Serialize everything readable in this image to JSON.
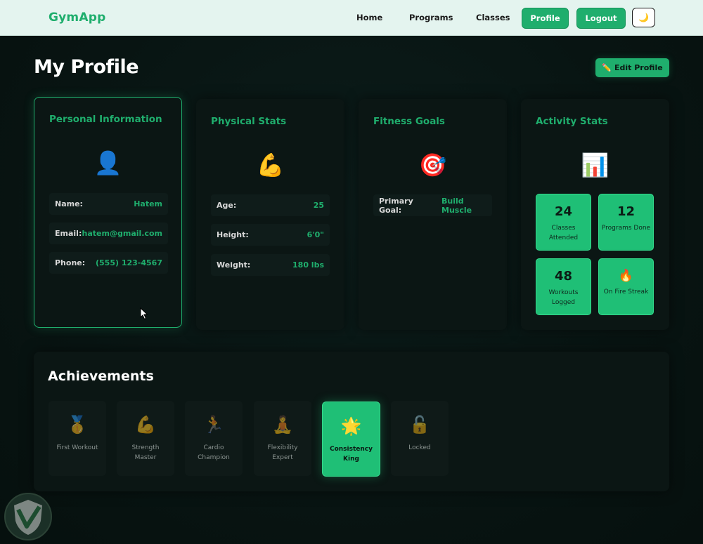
{
  "nav": {
    "logo": "GymApp",
    "links": [
      "Home",
      "Programs",
      "Classes"
    ],
    "profile_label": "Profile",
    "logout_label": "Logout",
    "theme_icon": "moon-icon"
  },
  "page": {
    "title": "My Profile",
    "edit_label": "Edit Profile",
    "edit_icon": "pencil-icon"
  },
  "personal": {
    "title": "Personal Information",
    "icon": "user-icon",
    "rows": [
      {
        "label": "Name:",
        "value": "Hatem"
      },
      {
        "label": "Email:",
        "value": "hatem@gmail.com"
      },
      {
        "label": "Phone:",
        "value": "(555) 123-4567"
      }
    ]
  },
  "physical": {
    "title": "Physical Stats",
    "icon": "flexed-biceps-icon",
    "rows": [
      {
        "label": "Age:",
        "value": "25"
      },
      {
        "label": "Height:",
        "value": "6'0\""
      },
      {
        "label": "Weight:",
        "value": "180 lbs"
      }
    ]
  },
  "goals": {
    "title": "Fitness Goals",
    "icon": "target-icon",
    "rows": [
      {
        "label": "Primary Goal:",
        "value": "Build Muscle"
      }
    ]
  },
  "activity": {
    "title": "Activity Stats",
    "icon": "bar-chart-icon",
    "stats": [
      {
        "value": "24",
        "label": "Classes Attended"
      },
      {
        "value": "12",
        "label": "Programs Done"
      },
      {
        "value": "48",
        "label": "Workouts Logged"
      },
      {
        "value": "",
        "label": "On Fire Streak",
        "icon": "fire-icon"
      }
    ]
  },
  "achievements": {
    "title": "Achievements",
    "items": [
      {
        "label": "First Workout",
        "icon": "medal-icon",
        "unlocked": false
      },
      {
        "label": "Strength Master",
        "icon": "flexed-biceps-icon",
        "unlocked": false
      },
      {
        "label": "Cardio Champion",
        "icon": "runner-icon",
        "unlocked": false
      },
      {
        "label": "Flexibility Expert",
        "icon": "yoga-icon",
        "unlocked": false
      },
      {
        "label": "Consistency King",
        "icon": "star-icon",
        "unlocked": true
      },
      {
        "label": "Locked",
        "icon": "lock-icon",
        "unlocked": false
      }
    ]
  },
  "colors": {
    "accent": "#1fae6d",
    "background": "#081412",
    "card": "#0b1614"
  }
}
